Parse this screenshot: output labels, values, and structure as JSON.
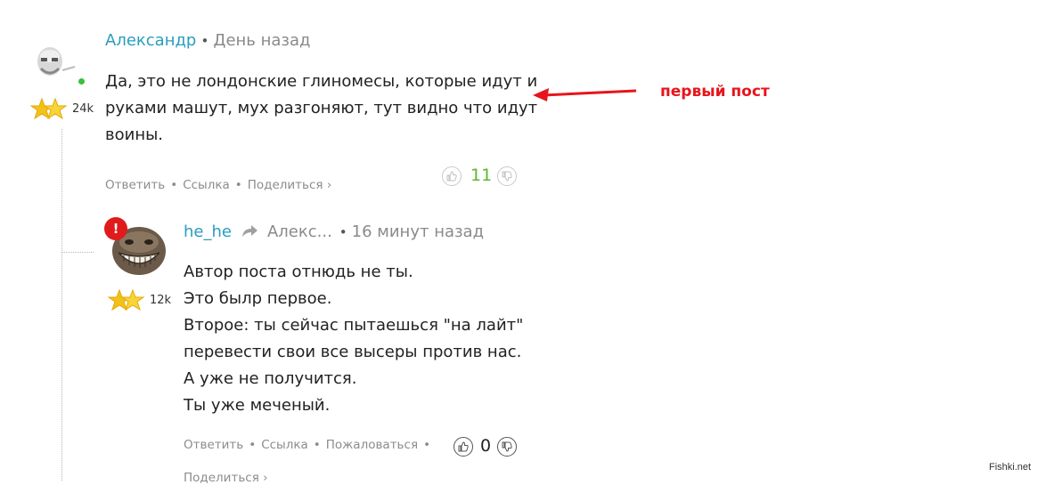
{
  "comments": [
    {
      "author": "Александр",
      "dot": "•",
      "time": "День назад",
      "rating": "24k",
      "online": true,
      "lines": [
        "Да, это не лондонские глиномесы, которые идут и",
        "руками машут, мух разгоняют, тут видно что идут",
        "воины."
      ],
      "actions": {
        "reply": "Ответить",
        "link": "Ссылка",
        "share": "Поделиться ›",
        "sep": "•"
      },
      "score": "11",
      "score_color": "#5cb82e"
    },
    {
      "author": "he_he",
      "reply_to": "Алекс...",
      "dot": "•",
      "time": "16 минут назад",
      "rating": "12k",
      "alert": "!",
      "lines": [
        "Автор поста отнюдь не ты.",
        "Это былр первое.",
        "Второе: ты сейчас пытаешься \"на лайт\"",
        "перевести свои все высеры против нас.",
        "А уже не получится.",
        "Ты уже меченый."
      ],
      "actions": {
        "reply": "Ответить",
        "link": "Ссылка",
        "report": "Пожаловаться",
        "share": "Поделиться ›",
        "sep": "•"
      },
      "score": "0",
      "score_color": "#222222"
    }
  ],
  "annotation": {
    "label": "первый пост",
    "color": "#e8141c"
  },
  "watermark": "Fishki.net",
  "icons": {
    "like": "thumb-up-icon",
    "dislike": "thumb-down-icon",
    "star": "star-icon",
    "reply_arrow": "reply-arrow-icon"
  }
}
